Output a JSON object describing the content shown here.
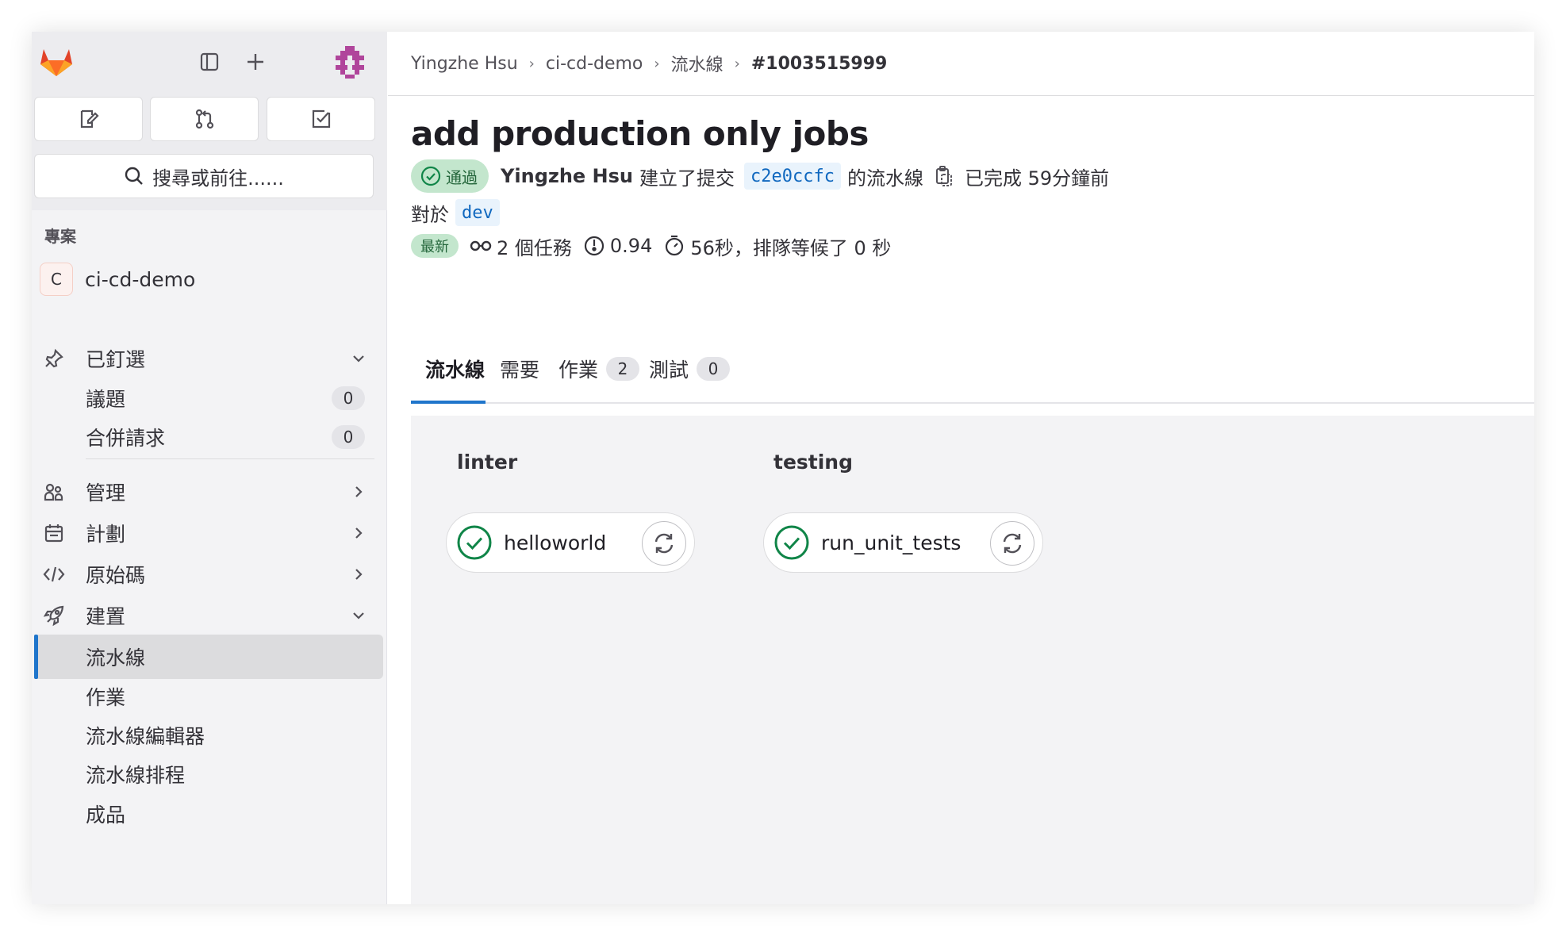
{
  "sidebar": {
    "search_label": "搜尋或前往......",
    "section_label": "專案",
    "project": {
      "initial": "C",
      "name": "ci-cd-demo"
    },
    "pinned": {
      "label": "已釘選",
      "items": [
        {
          "label": "議題",
          "count": "0"
        },
        {
          "label": "合併請求",
          "count": "0"
        }
      ]
    },
    "nav": [
      {
        "label": "管理",
        "icon": "users-icon"
      },
      {
        "label": "計劃",
        "icon": "calendar-icon"
      },
      {
        "label": "原始碼",
        "icon": "code-icon"
      },
      {
        "label": "建置",
        "icon": "rocket-icon"
      }
    ],
    "build_items": [
      {
        "label": "流水線"
      },
      {
        "label": "作業"
      },
      {
        "label": "流水線編輯器"
      },
      {
        "label": "流水線排程"
      },
      {
        "label": "成品"
      }
    ]
  },
  "breadcrumb": {
    "items": [
      "Yingzhe Hsu",
      "ci-cd-demo",
      "流水線",
      "#1003515999"
    ]
  },
  "pipeline": {
    "title": "add production only jobs",
    "status": "通過",
    "author": "Yingzhe Hsu",
    "created_text": "建立了提交",
    "commit_sha": "c2e0ccfc",
    "of_pipeline": "的流水線",
    "finished_text": "已完成 59分鐘前",
    "for_text": "對於",
    "ref": "dev",
    "latest_badge": "最新",
    "jobs_text": "2 個任務",
    "coverage": "0.94",
    "duration_text": "56秒，排隊等候了 0 秒"
  },
  "tabs": [
    {
      "label": "流水線",
      "count": null
    },
    {
      "label": "需要",
      "count": null
    },
    {
      "label": "作業",
      "count": "2"
    },
    {
      "label": "測試",
      "count": "0"
    }
  ],
  "stages": [
    {
      "name": "linter",
      "jobs": [
        {
          "name": "helloworld",
          "status": "passed"
        }
      ]
    },
    {
      "name": "testing",
      "jobs": [
        {
          "name": "run_unit_tests",
          "status": "passed"
        }
      ]
    }
  ],
  "colors": {
    "accent": "#1f75cb",
    "success": "#108548",
    "success_bg": "#c3e6cd",
    "sha_text": "#1068bf"
  }
}
